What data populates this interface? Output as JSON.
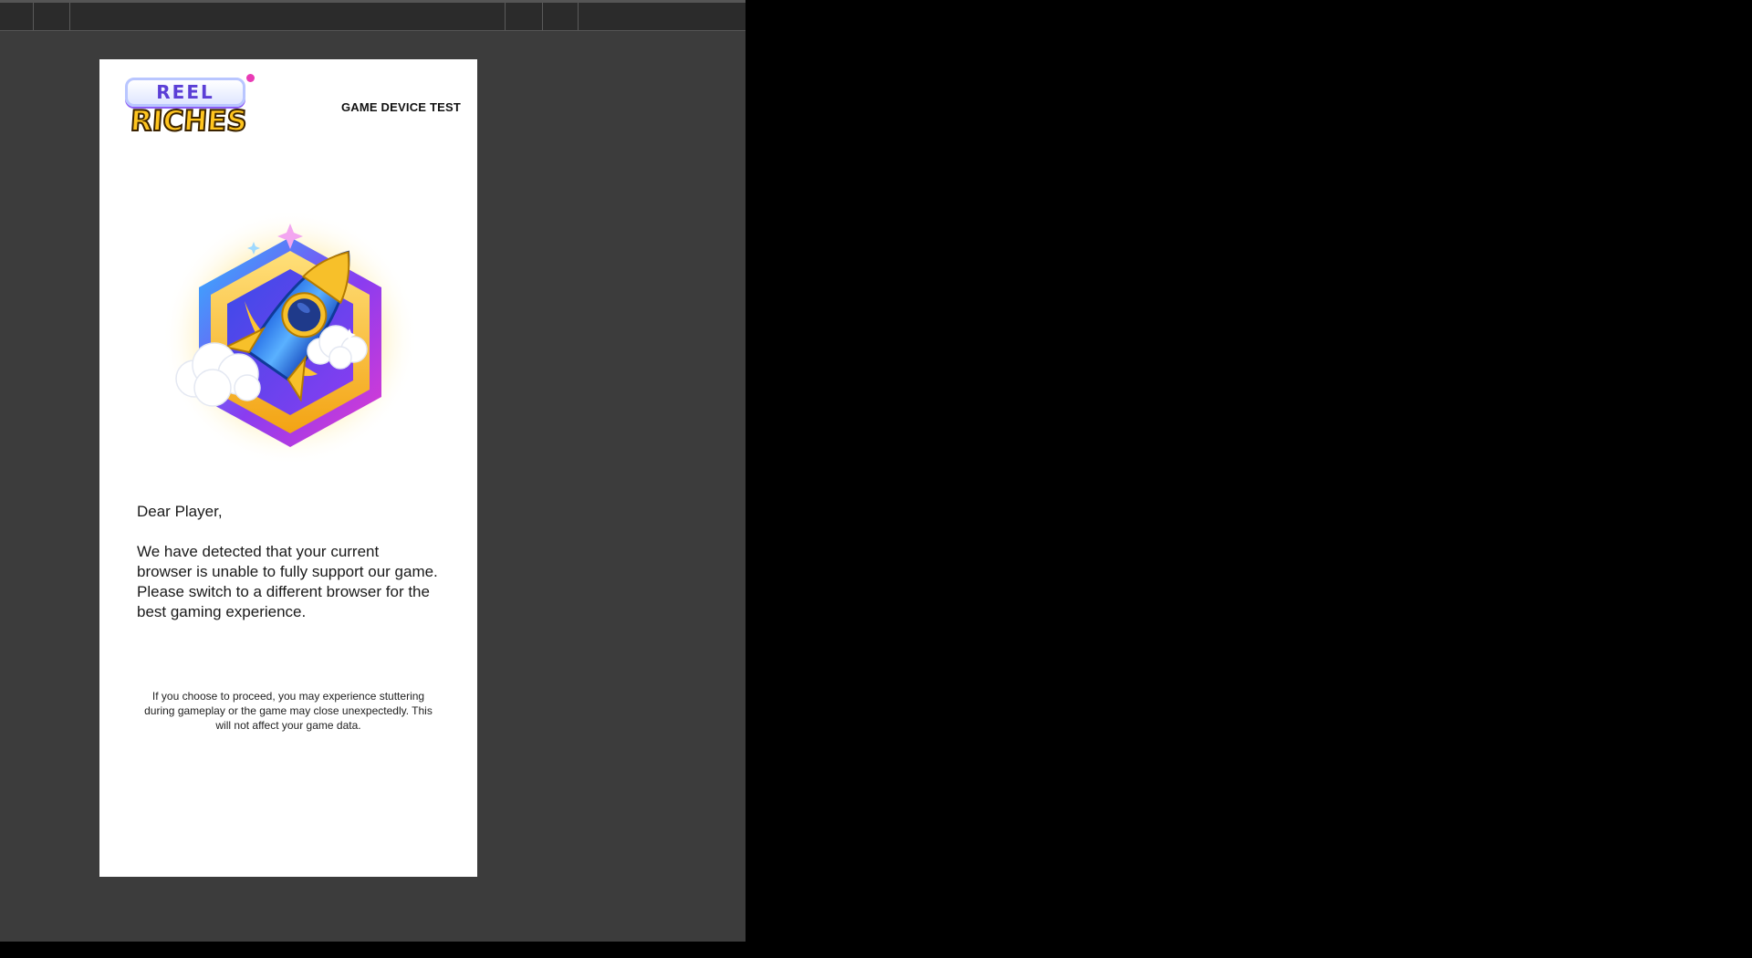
{
  "brand": {
    "logo_top": "REEL",
    "logo_bottom": "RICHES"
  },
  "header": {
    "title": "GAME DEVICE TEST"
  },
  "hero": {
    "icon": "rocket-icon"
  },
  "message": {
    "greeting": "Dear Player,",
    "body": "We have detected that your current browser is unable to fully support our game. Please switch to a different browser for the best gaming experience."
  },
  "disclaimer": {
    "text": "If you choose to proceed, you may experience stuttering during gameplay or the game may close unexpectedly. This will not affect your game data."
  },
  "colors": {
    "panel_bg": "#3c3c3c",
    "device_bg": "#ffffff",
    "logo_gold": "#ffc51f",
    "logo_purple": "#5b3fd6"
  }
}
